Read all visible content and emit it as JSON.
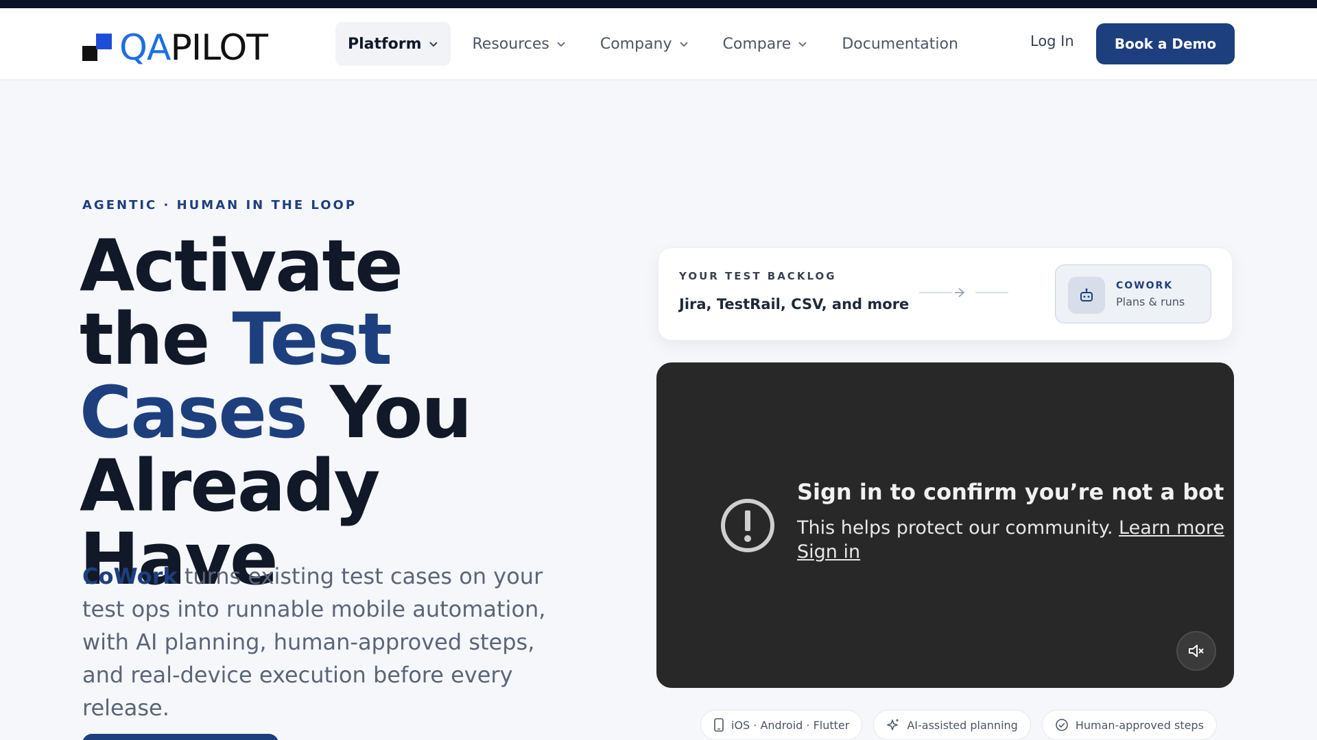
{
  "header": {
    "logo": {
      "qa": "QA",
      "pilot": "PILOT"
    },
    "nav": [
      {
        "label": "Platform",
        "has_dropdown": true,
        "active": true
      },
      {
        "label": "Resources",
        "has_dropdown": true
      },
      {
        "label": "Company",
        "has_dropdown": true
      },
      {
        "label": "Compare",
        "has_dropdown": true
      },
      {
        "label": "Documentation",
        "has_dropdown": false
      }
    ],
    "login_label": "Log In",
    "cta_label": "Book a Demo"
  },
  "hero": {
    "eyebrow": "AGENTIC · HUMAN IN THE LOOP",
    "headline": {
      "line1": "Activate",
      "line2_plain": "the ",
      "line2_accent": "Test",
      "line3_accent": "Cases",
      "line3_plain": " You",
      "line4": "Already Have"
    },
    "description": {
      "brand": "CoWork",
      "text": " turns existing test cases on your test ops into runnable mobile automation, with AI planning, human-approved steps, and real-device execution before every release."
    }
  },
  "backlog_card": {
    "label": "YOUR TEST BACKLOG",
    "sources": "Jira, TestRail, CSV, and more",
    "cowork": {
      "title": "COWORK",
      "subtitle": "Plans & runs",
      "icon": "robot-icon"
    }
  },
  "video": {
    "title": "Sign in to confirm you’re not a bot",
    "message": "This helps protect our community. ",
    "learn_more": "Learn more",
    "sign_in": "Sign in",
    "mute_icon": "mute-icon"
  },
  "pills": [
    {
      "label": "iOS · Android · Flutter",
      "icon": "phone-icon"
    },
    {
      "label": "AI-assisted planning",
      "icon": "sparkle-icon"
    },
    {
      "label": "Human-approved steps",
      "icon": "check-circle-icon"
    }
  ],
  "colors": {
    "brand": "#1e3f7e",
    "logo_blue": "#1d6fe0",
    "video_bg": "#282828"
  }
}
